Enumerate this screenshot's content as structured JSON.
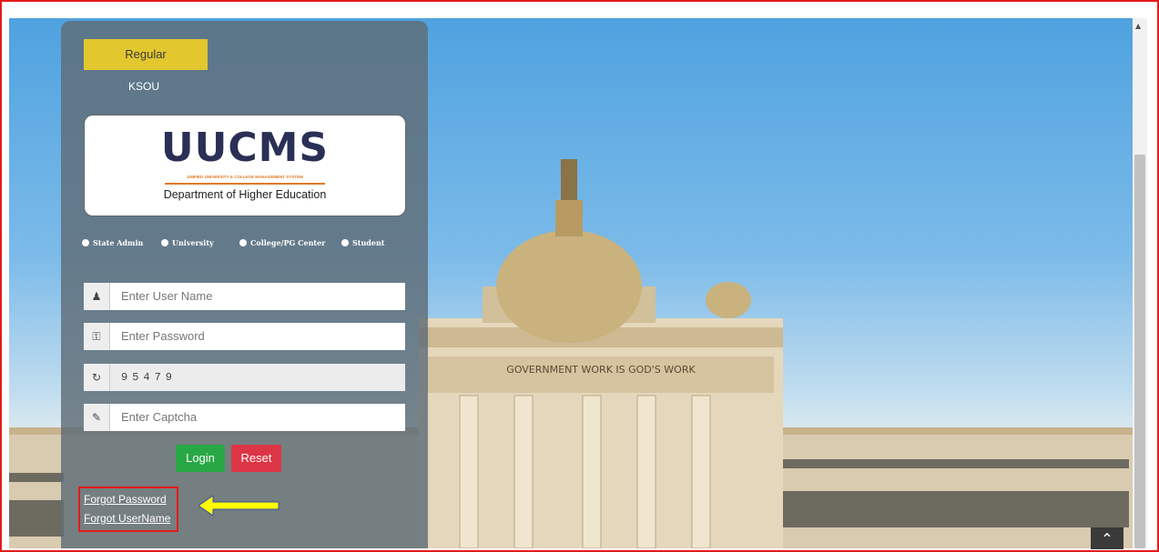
{
  "tabs": {
    "regular": "Regular",
    "ksou": "KSOU"
  },
  "logo": {
    "brand": "UUCMS",
    "tagline": "UNIFIED UNIVERSITY & COLLEGE MANAGEMENT SYSTEM",
    "department": "Department of Higher Education"
  },
  "roles": [
    "State Admin",
    "University",
    "College/PG Center",
    "Student"
  ],
  "form": {
    "username_placeholder": "Enter User Name",
    "password_placeholder": "Enter Password",
    "captcha_code": "95479",
    "captcha_placeholder": "Enter Captcha",
    "login_label": "Login",
    "reset_label": "Reset"
  },
  "links": {
    "forgot_password": "Forgot Password",
    "forgot_username": "Forgot UserName"
  },
  "background": {
    "inscription": "GOVERNMENT WORK IS GOD'S WORK"
  },
  "colors": {
    "accent_tab": "#e2c72f",
    "login": "#28a745",
    "reset": "#dc3545",
    "highlight": "#e31b1b",
    "arrow": "#ffff00"
  },
  "icons": {
    "user": "user-icon",
    "key": "key-icon",
    "refresh": "refresh-icon",
    "edit": "edit-icon",
    "to_top": "chevron-up-icon"
  }
}
